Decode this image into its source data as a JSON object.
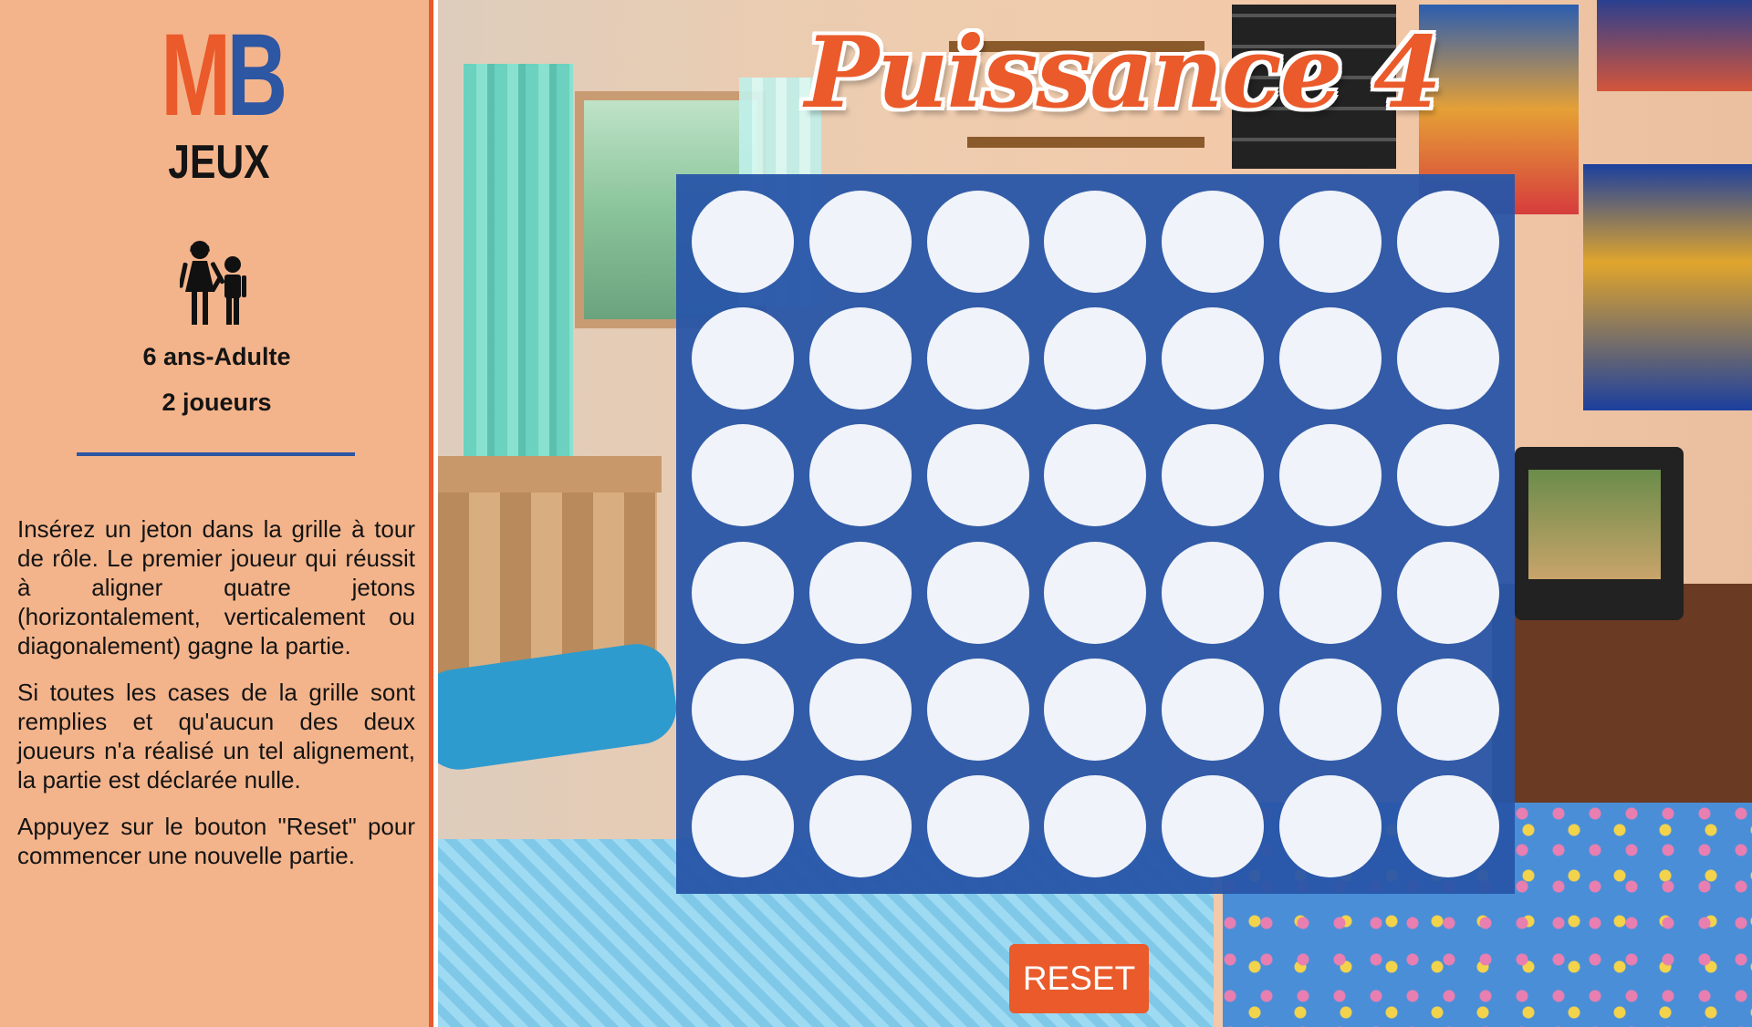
{
  "sidebar": {
    "logo": {
      "letter_m": "M",
      "letter_b": "B",
      "subtitle": "JEUX"
    },
    "players_icon": "two-children-icon",
    "age": "6 ans-Adulte",
    "players": "2 joueurs",
    "rules": [
      "Insérez un jeton dans la grille à tour de rôle. Le premier joueur qui réussit à aligner quatre jetons (horizontalement, verticalement ou diagonalement) gagne la partie.",
      "Si toutes les cases de la grille sont remplies et qu'aucun des deux joueurs n'a réalisé un tel alignement, la partie est déclarée nulle.",
      "Appuyez sur le bouton \"Reset\" pour commencer une nouvelle partie."
    ]
  },
  "game": {
    "title": "Puissance 4",
    "columns": 7,
    "rows": 6,
    "cells": [
      [
        "",
        "",
        "",
        "",
        "",
        "",
        ""
      ],
      [
        "",
        "",
        "",
        "",
        "",
        "",
        ""
      ],
      [
        "",
        "",
        "",
        "",
        "",
        "",
        ""
      ],
      [
        "",
        "",
        "",
        "",
        "",
        "",
        ""
      ],
      [
        "",
        "",
        "",
        "",
        "",
        "",
        ""
      ],
      [
        "",
        "",
        "",
        "",
        "",
        "",
        ""
      ]
    ],
    "reset_label": "RESET"
  },
  "colors": {
    "accent_orange": "#ea5a2a",
    "brand_blue": "#2d56a3",
    "sidebar_bg": "#f4b48b",
    "board_blue": "#2855a8"
  }
}
